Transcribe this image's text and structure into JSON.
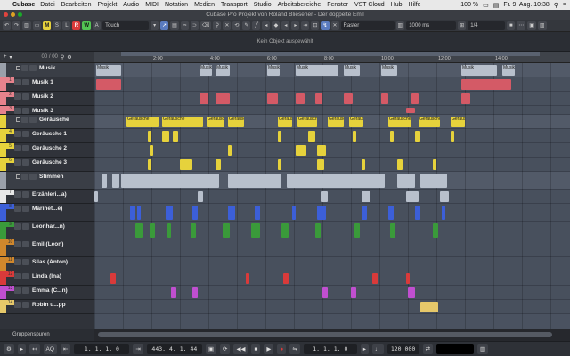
{
  "menubar": {
    "app": "Cubase",
    "items": [
      "Datei",
      "Bearbeiten",
      "Projekt",
      "Audio",
      "MIDI",
      "Notation",
      "Medien",
      "Transport",
      "Studio",
      "Arbeitsbereiche",
      "Fenster",
      "VST Cloud",
      "Hub",
      "Hilfe"
    ],
    "battery": "100 %",
    "datetime": "Fr. 9. Aug.  10:38"
  },
  "window": {
    "title": "Cubase Pro Projekt von Roland Bliesener - Der doppelte Emil"
  },
  "toolbar": {
    "m": "M",
    "s": "S",
    "l": "L",
    "r": "R",
    "w": "W",
    "a": "A",
    "automation_mode": "Touch",
    "snap_type": "Raster",
    "quantize": "1000 ms",
    "grid": "1/4"
  },
  "infoline": {
    "text": "Kein Objekt ausgewählt"
  },
  "trackhdr": {
    "counter": "00 / 00"
  },
  "ruler": {
    "ticks": [
      "2:00",
      "4:00",
      "6:00",
      "8:00",
      "10:00",
      "12:00",
      "14:00"
    ]
  },
  "tracks": [
    {
      "name": "Musik",
      "num": "",
      "color": "#9aa0aa",
      "folder": true
    },
    {
      "name": "Musik 1",
      "num": "1",
      "color": "#e6828c"
    },
    {
      "name": "Musik 2",
      "num": "2",
      "color": "#e6828c"
    },
    {
      "name": "Musik 3",
      "num": "3",
      "color": "#e6828c"
    },
    {
      "name": "Geräusche",
      "num": "",
      "color": "#e6d23c",
      "folder": true
    },
    {
      "name": "Geräusche 1",
      "num": "4",
      "color": "#e6d23c"
    },
    {
      "name": "Geräusche 2",
      "num": "5",
      "color": "#e6d23c"
    },
    {
      "name": "Geräusche 3",
      "num": "6",
      "color": "#e6d23c"
    },
    {
      "name": "Stimmen",
      "num": "",
      "color": "#9aa0aa",
      "folder": true
    },
    {
      "name": "Erzähleri...a)",
      "num": "7",
      "color": "#e8e8e8"
    },
    {
      "name": "Marinet...e)",
      "num": "8",
      "color": "#3c5fd8"
    },
    {
      "name": "Leonhar...n)",
      "num": "9",
      "color": "#3a9a3a"
    },
    {
      "name": "Emil (Leon)",
      "num": "10",
      "color": "#d0872c"
    },
    {
      "name": "Silas (Anton)",
      "num": "11",
      "color": "#d0872c"
    },
    {
      "name": "Linda (Ina)",
      "num": "12",
      "color": "#d93a3a"
    },
    {
      "name": "Emma (C...n)",
      "num": "13",
      "color": "#c04fd0"
    },
    {
      "name": "Robin u...pp",
      "num": "14",
      "color": "#e6c86a"
    }
  ],
  "bottom": {
    "group_label": "Gruppenspuren"
  },
  "events": {
    "musik_label": "Musik",
    "geraeusche_label": "Geräusche",
    "stimmen_label": "Stimmen"
  },
  "transport": {
    "left_locator": "1. 1. 1.  0",
    "right_locator": "443. 4. 1. 44",
    "position": "1. 1. 1.  0",
    "tempo": "120.000"
  },
  "colors": {
    "musik": "#d45a66",
    "geraeusche": "#e6d23c",
    "stimmen": "#b8c0cc",
    "marinette": "#3c5fd8",
    "leonhard": "#3a9a3a",
    "linda": "#d93a3a",
    "emma": "#c04fd0",
    "robin": "#e6c86a"
  }
}
